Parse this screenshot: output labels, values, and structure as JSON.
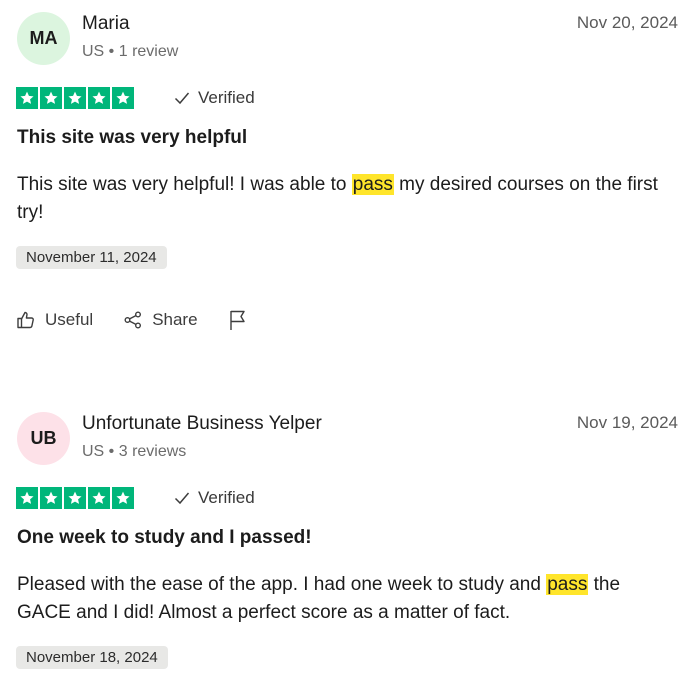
{
  "reviews": [
    {
      "initials": "MA",
      "avatar_color": "#dcf5df",
      "name": "Maria",
      "meta": "US • 1 review",
      "date": "Nov 20, 2024",
      "rating": 5,
      "verified_label": "Verified",
      "title": "This site was very helpful",
      "body_before": "This site was very helpful! I was able to ",
      "body_highlight": "pass",
      "body_after": " my desired courses on the first try!",
      "experience_date": "November 11, 2024",
      "useful_label": "Useful",
      "share_label": "Share"
    },
    {
      "initials": "UB",
      "avatar_color": "#fde1e8",
      "name": "Unfortunate Business Yelper",
      "meta": "US • 3 reviews",
      "date": "Nov 19, 2024",
      "rating": 5,
      "verified_label": "Verified",
      "title": "One week to study and I passed!",
      "body_before": "Pleased with the ease of the app. I had one week to study and ",
      "body_highlight": "pass",
      "body_after": " the GACE and I did! Almost a perfect score as a matter of fact.",
      "experience_date": "November 18, 2024"
    }
  ],
  "colors": {
    "star_green": "#00b67a",
    "highlight": "#ffe52b",
    "badge_bg": "#e8e8e6"
  }
}
